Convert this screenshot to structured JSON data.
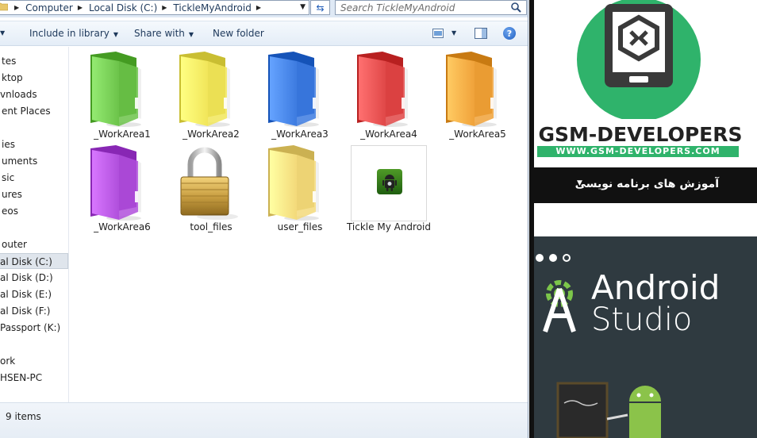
{
  "address": {
    "crumbs": [
      "Computer",
      "Local Disk (C:)",
      "TickleMyAndroid"
    ],
    "search_placeholder": "Search TickleMyAndroid"
  },
  "toolbar": {
    "include_label": "Include in library",
    "share_label": "Share with",
    "newfolder_label": "New folder"
  },
  "nav": {
    "items": [
      "tes",
      "ktop",
      "vnloads",
      "ent Places",
      "ies",
      "uments",
      "sic",
      "ures",
      "eos",
      "outer",
      "al Disk (C:)",
      "al Disk (D:)",
      "al Disk (E:)",
      "al Disk (F:)",
      "Passport (K:)",
      "ork",
      "HSEN-PC"
    ],
    "selected": "al Disk (C:)"
  },
  "files": [
    {
      "label": "_WorkArea1",
      "color": "#6cc34a"
    },
    {
      "label": "_WorkArea2",
      "color": "#f1e65a"
    },
    {
      "label": "_WorkArea3",
      "color": "#3d7be0"
    },
    {
      "label": "_WorkArea4",
      "color": "#e04848"
    },
    {
      "label": "_WorkArea5",
      "color": "#f0a23a"
    },
    {
      "label": "_WorkArea6",
      "color": "#b04fdc"
    },
    {
      "label": "tool_files",
      "icon": "padlock-icon"
    },
    {
      "label": "user_files",
      "color": "#f3d97a"
    },
    {
      "label": "Tickle My Android",
      "icon": "android-app-icon"
    }
  ],
  "status": {
    "text": "9 items"
  },
  "web": {
    "brand": "GSM-DEVELOPERS",
    "url": "WWW.GSM-DEVELOPERS.COM",
    "menu_item": "آموزش های برنامه نویسی",
    "slider_title_line1": "Android",
    "slider_title_line2": "Studio",
    "accent": "#2fb36b"
  }
}
